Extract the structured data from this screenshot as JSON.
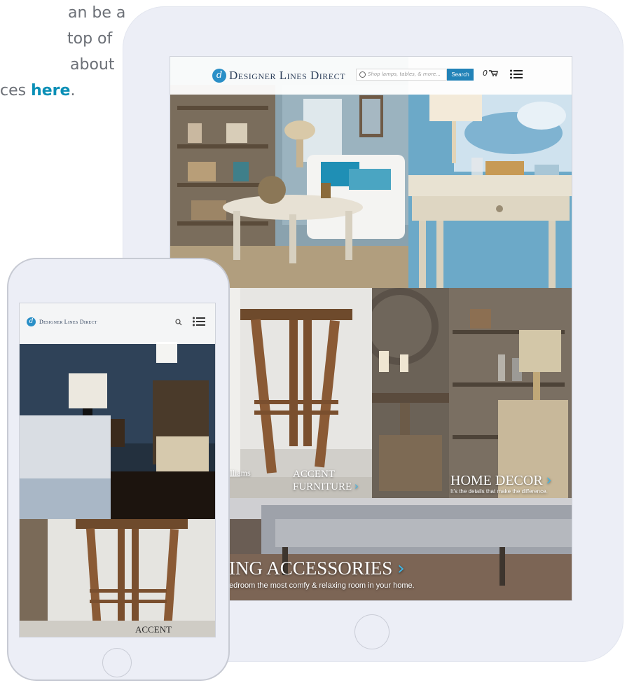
{
  "intro": {
    "line1": "an be a",
    "line2": "top of",
    "line3": "about",
    "line4_prefix": "ces",
    "link_text": "here",
    "line4_suffix": "."
  },
  "tablet": {
    "brand": "Designer Lines Direct",
    "logo_letter": "d",
    "search_placeholder": "Shop lamps, tables, & more...",
    "search_button": "Search",
    "cart_count": "0",
    "panels": {
      "accent_line1": "ACCENT",
      "accent_line2": "FURNITURE",
      "accent_watermark": "illiams",
      "decor_title": "HOME DECOR",
      "decor_tagline": "It's the details that make the difference.",
      "bedding_title": "ING ACCESSORIES",
      "bedding_tagline": "edroom the most comfy & relaxing room in your home."
    }
  },
  "phone": {
    "brand": "Designer Lines Direct",
    "logo_letter": "d",
    "accent_label": "ACCENT"
  },
  "colors": {
    "accent": "#0a8fb6",
    "brand_blue": "#2283b8",
    "chevron": "#3fb6e6"
  }
}
